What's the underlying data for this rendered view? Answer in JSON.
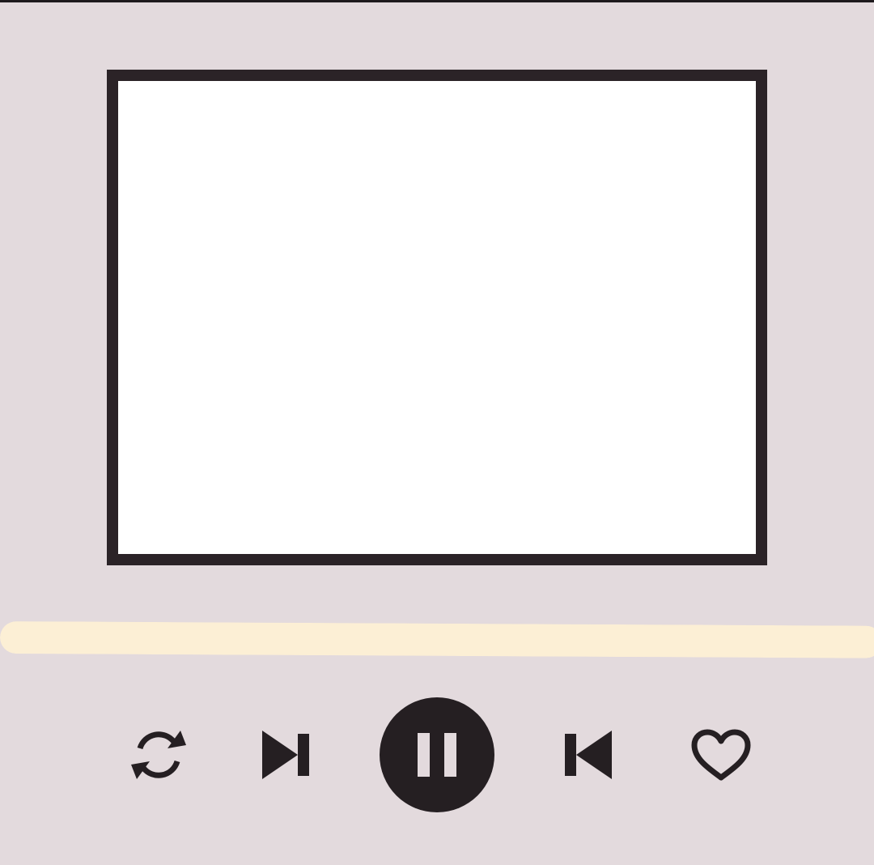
{
  "colors": {
    "background": "#e3dadd",
    "frame_border": "#2b2327",
    "artwork_fill": "#ffffff",
    "progress_bar": "#fcefd5",
    "icon": "#251f22",
    "pause_glyph": "#e3dadd"
  },
  "player": {
    "state": "playing",
    "progress_fraction": 1.0,
    "controls": [
      {
        "name": "repeat-button",
        "icon": "repeat-icon"
      },
      {
        "name": "next-button",
        "icon": "skip-next-icon"
      },
      {
        "name": "play-pause-button",
        "icon": "pause-icon"
      },
      {
        "name": "prev-button",
        "icon": "skip-previous-icon"
      },
      {
        "name": "like-button",
        "icon": "heart-outline-icon"
      }
    ]
  }
}
